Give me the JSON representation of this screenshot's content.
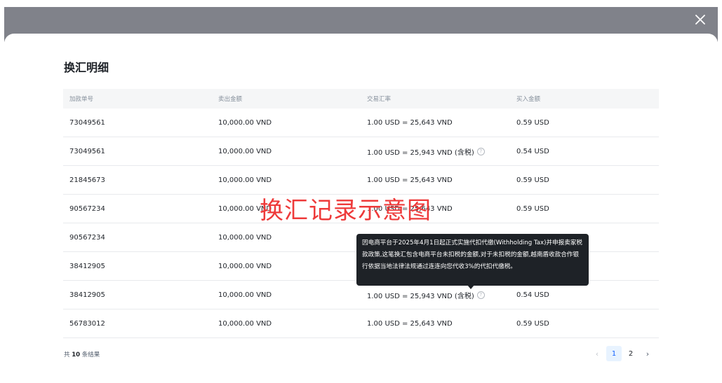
{
  "modal": {
    "title": "换汇明细",
    "close_icon": "close-icon"
  },
  "table": {
    "headers": [
      "加款单号",
      "卖出金额",
      "交易汇率",
      "买入金额"
    ],
    "rows": [
      {
        "id": "73049561",
        "sell": "10,000.00 VND",
        "rate": "1.00 USD = 25,643 VND",
        "has_tax_icon": false,
        "buy": "0.59 USD"
      },
      {
        "id": "73049561",
        "sell": "10,000.00 VND",
        "rate": "1.00 USD = 25,943 VND (含税)",
        "has_tax_icon": true,
        "buy": "0.54 USD"
      },
      {
        "id": "21845673",
        "sell": "10,000.00 VND",
        "rate": "1.00 USD = 25,643 VND",
        "has_tax_icon": false,
        "buy": "0.59 USD"
      },
      {
        "id": "90567234",
        "sell": "10,000.00 VND",
        "rate": "1.00 USD = 25,643 VND",
        "has_tax_icon": false,
        "buy": "0.59 USD"
      },
      {
        "id": "90567234",
        "sell": "10,000.00 VND",
        "rate": "",
        "has_tax_icon": false,
        "buy": ""
      },
      {
        "id": "38412905",
        "sell": "10,000.00 VND",
        "rate": "",
        "has_tax_icon": false,
        "buy": ""
      },
      {
        "id": "38412905",
        "sell": "10,000.00 VND",
        "rate": "1.00 USD = 25,943 VND (含税)",
        "has_tax_icon": true,
        "buy": "0.54 USD"
      },
      {
        "id": "56783012",
        "sell": "10,000.00 VND",
        "rate": "1.00 USD = 25,643 VND",
        "has_tax_icon": false,
        "buy": "0.59 USD"
      }
    ]
  },
  "overlay_caption": "换汇记录示意图",
  "tooltip": {
    "text": "因电商平台于2025年4月1日起正式实施代扣代缴(Withholding Tax)并申报卖家税款政策,这笔换汇包含电商平台未扣税的金额,对于未扣税的金额,越南盾收款合作银行依据当地法律法规通过连连向您代收3%的代扣代缴税。"
  },
  "footer": {
    "total_prefix": "共",
    "total_count": "10",
    "total_suffix": "条结果"
  },
  "pagination": {
    "prev": "‹",
    "pages": [
      "1",
      "2"
    ],
    "current": "1",
    "next": "›"
  },
  "colors": {
    "accent": "#1664ff",
    "tooltip_bg": "#1e2227",
    "caption": "#ee3a3a"
  }
}
